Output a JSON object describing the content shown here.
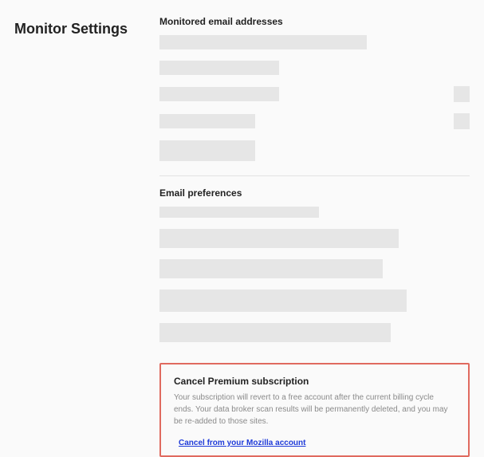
{
  "page": {
    "title": "Monitor Settings"
  },
  "emails": {
    "heading": "Monitored email addresses"
  },
  "prefs": {
    "heading": "Email preferences"
  },
  "cancel": {
    "heading": "Cancel Premium subscription",
    "description": "Your subscription will revert to a free account after the current billing cycle ends. Your data broker scan results will be permanently deleted, and you may be re-added to those sites.",
    "link": "Cancel from your Mozilla account"
  }
}
